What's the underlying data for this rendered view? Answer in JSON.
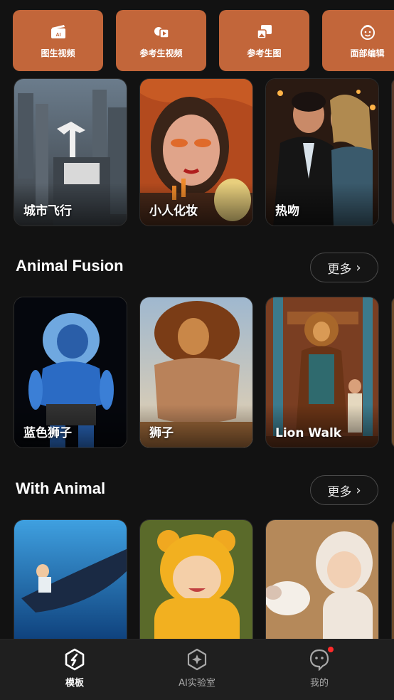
{
  "tools": [
    {
      "label": "图生视频",
      "icon": "image-to-video-icon"
    },
    {
      "label": "参考生视频",
      "icon": "reference-video-icon"
    },
    {
      "label": "参考生图",
      "icon": "reference-image-icon"
    },
    {
      "label": "面部编辑",
      "icon": "face-edit-icon"
    }
  ],
  "first_row": [
    {
      "label": "城市飞行"
    },
    {
      "label": "小人化妆"
    },
    {
      "label": "热吻"
    }
  ],
  "sections": [
    {
      "title": "Animal Fusion",
      "more": "更多",
      "cards": [
        {
          "label": "蓝色狮子"
        },
        {
          "label": "狮子"
        },
        {
          "label": "Lion Walk"
        }
      ]
    },
    {
      "title": "With Animal",
      "more": "更多",
      "cards": [
        {
          "label": ""
        },
        {
          "label": ""
        },
        {
          "label": ""
        }
      ]
    }
  ],
  "nav": [
    {
      "label": "模板",
      "icon": "template-icon",
      "active": true
    },
    {
      "label": "AI实验室",
      "icon": "ai-lab-icon",
      "active": false
    },
    {
      "label": "我的",
      "icon": "profile-icon",
      "active": false,
      "badge": true
    }
  ],
  "colors": {
    "background": "#121212",
    "tool_button": "#c2663a",
    "nav_bar": "#1f1f1f",
    "badge": "#ff2a2a"
  }
}
